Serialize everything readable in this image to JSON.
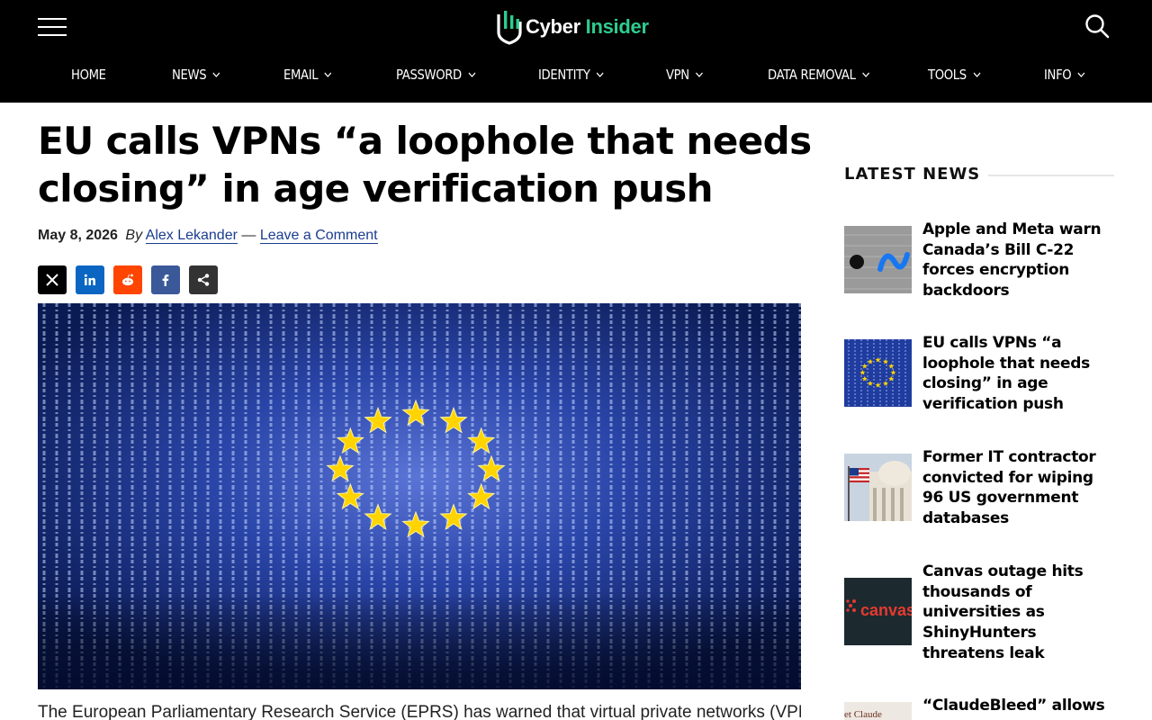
{
  "site": {
    "logo_text_main": "Cyber",
    "logo_text_accent": "Insider",
    "accent_color": "#2ecc8f",
    "header_bg": "#000000"
  },
  "nav": [
    {
      "label": "HOME",
      "has_dropdown": false
    },
    {
      "label": "NEWS",
      "has_dropdown": true
    },
    {
      "label": "EMAIL",
      "has_dropdown": true
    },
    {
      "label": "PASSWORD",
      "has_dropdown": true
    },
    {
      "label": "IDENTITY",
      "has_dropdown": true
    },
    {
      "label": "VPN",
      "has_dropdown": true
    },
    {
      "label": "DATA REMOVAL",
      "has_dropdown": true
    },
    {
      "label": "TOOLS",
      "has_dropdown": true
    },
    {
      "label": "INFO",
      "has_dropdown": true
    }
  ],
  "article": {
    "title": "EU calls VPNs “a loophole that needs closing” in age verification push",
    "date": "May 8, 2026",
    "by": "By",
    "author": "Alex Lekander",
    "separator": "—",
    "comment_link": "Leave a Comment",
    "lead_text": "The European Parliamentary Research Service (EPRS) has warned that virtual private networks (VPNs) are"
  },
  "share_buttons": [
    {
      "name": "x-share",
      "icon": "x-icon",
      "color": "#000000"
    },
    {
      "name": "linkedin-share",
      "icon": "linkedin-icon",
      "color": "#0a66c2"
    },
    {
      "name": "reddit-share",
      "icon": "reddit-icon",
      "color": "#ff4500"
    },
    {
      "name": "facebook-share",
      "icon": "facebook-icon",
      "color": "#3b5998"
    },
    {
      "name": "generic-share",
      "icon": "share-icon",
      "color": "#333333"
    }
  ],
  "sidebar": {
    "heading": "LATEST NEWS",
    "items": [
      {
        "title": "Apple and Meta warn Canada’s Bill C-22 forces encryption backdoors",
        "thumb": "apple-meta-thumbnail"
      },
      {
        "title": "EU calls VPNs “a loophole that needs closing” in age verification push",
        "thumb": "eu-binary-thumbnail"
      },
      {
        "title": "Former IT contractor convicted for wiping 96 US government databases",
        "thumb": "capitol-flag-thumbnail"
      },
      {
        "title": "Canvas outage hits thousands of universities as ShinyHunters threatens leak",
        "thumb": "canvas-logo-thumbnail",
        "thumb_text": "canvas"
      },
      {
        "title": "“ClaudeBleed” allows",
        "thumb": "claude-thumbnail",
        "thumb_text": "et Claude"
      }
    ]
  }
}
